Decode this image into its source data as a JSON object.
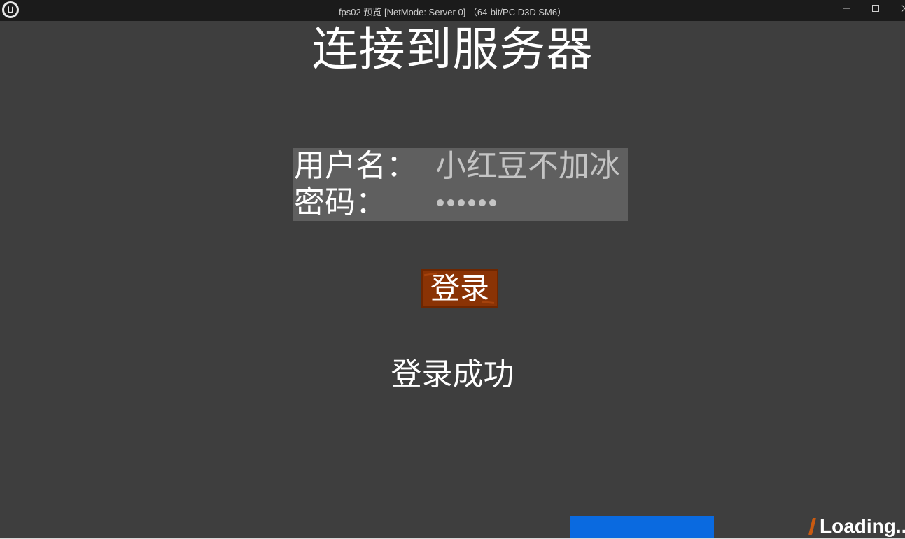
{
  "window": {
    "title": "fps02 预览 [NetMode: Server 0] （64-bit/PC D3D SM6）",
    "minimize_icon": "minimize-icon",
    "maximize_icon": "maximize-icon",
    "close_icon": "close-icon",
    "app_icon": "unreal-engine-logo-icon"
  },
  "page": {
    "title": "连接到服务器"
  },
  "login_form": {
    "username_label": "用户名：",
    "username_value": "小红豆不加冰",
    "password_label": "密码：",
    "password_mask_length": 6
  },
  "login_button": {
    "label": "登录",
    "color": "#8a3305"
  },
  "status": {
    "message": "登录成功"
  },
  "loading": {
    "text": "Loading..",
    "accent": "#c95a10"
  },
  "colors": {
    "background": "#3e3e3e",
    "panel": "#5f5f5f",
    "blue_bar": "#0a6ae0"
  }
}
